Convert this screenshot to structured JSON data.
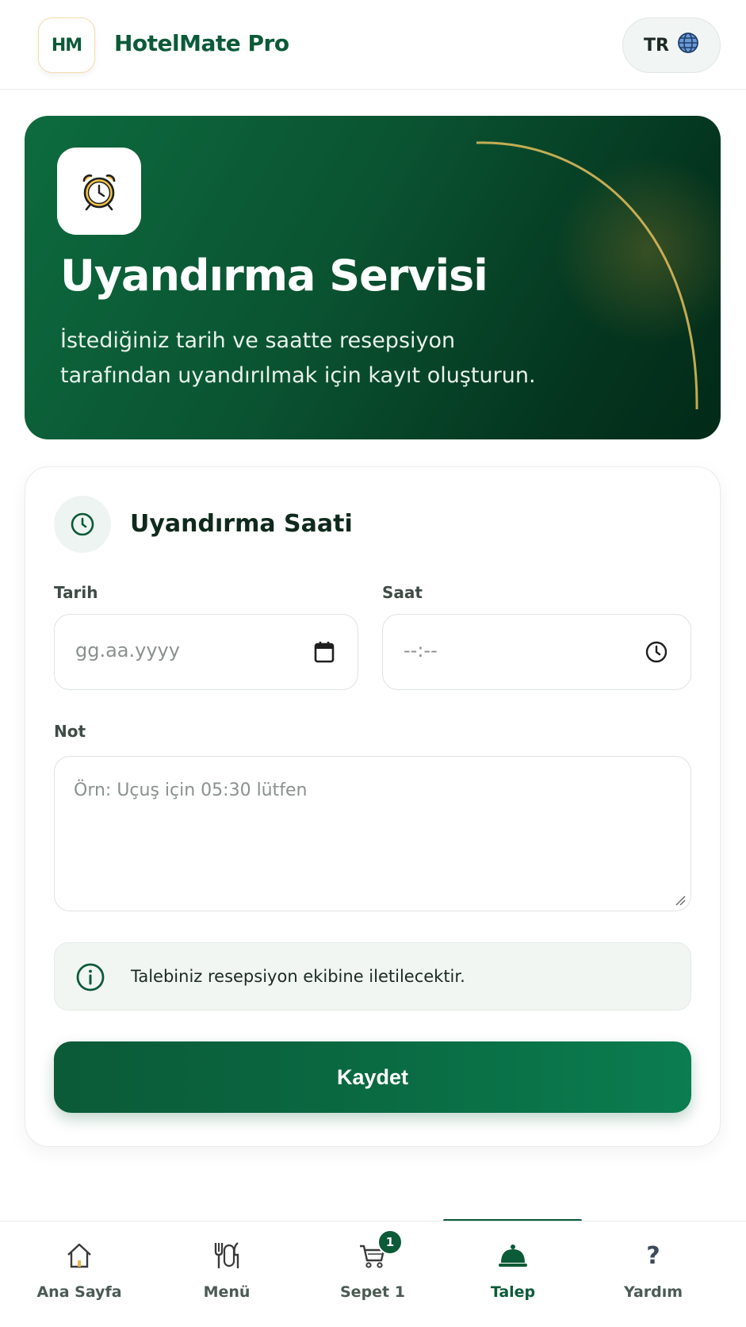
{
  "header": {
    "logo_text": "HM",
    "brand": "HotelMate Pro",
    "language": "TR"
  },
  "hero": {
    "title": "Uyandırma Servisi",
    "subtitle": "İstediğiniz tarih ve saatte resepsiyon tarafından uyandırılmak için kayıt oluşturun.",
    "icon": "alarm-clock-icon"
  },
  "form": {
    "title": "Uyandırma Saati",
    "date_label": "Tarih",
    "date_placeholder": "gg.aa.yyyy",
    "time_label": "Saat",
    "time_placeholder": "--:--",
    "note_label": "Not",
    "note_placeholder": "Örn: Uçuş için 05:30 lütfen",
    "info_text": "Talebiniz resepsiyon ekibine iletilecektir.",
    "save_label": "Kaydet"
  },
  "nav": {
    "items": [
      {
        "label": "Ana Sayfa",
        "icon": "home-icon"
      },
      {
        "label": "Menü",
        "icon": "utensils-icon"
      },
      {
        "label": "Sepet 1",
        "icon": "cart-icon",
        "badge": "1"
      },
      {
        "label": "Talep",
        "icon": "service-bell-icon",
        "active": true
      },
      {
        "label": "Yardım",
        "icon": "question-icon"
      }
    ]
  },
  "colors": {
    "primary": "#0b5a38",
    "accent_gold": "#d8b85a",
    "background": "#ffffff"
  }
}
